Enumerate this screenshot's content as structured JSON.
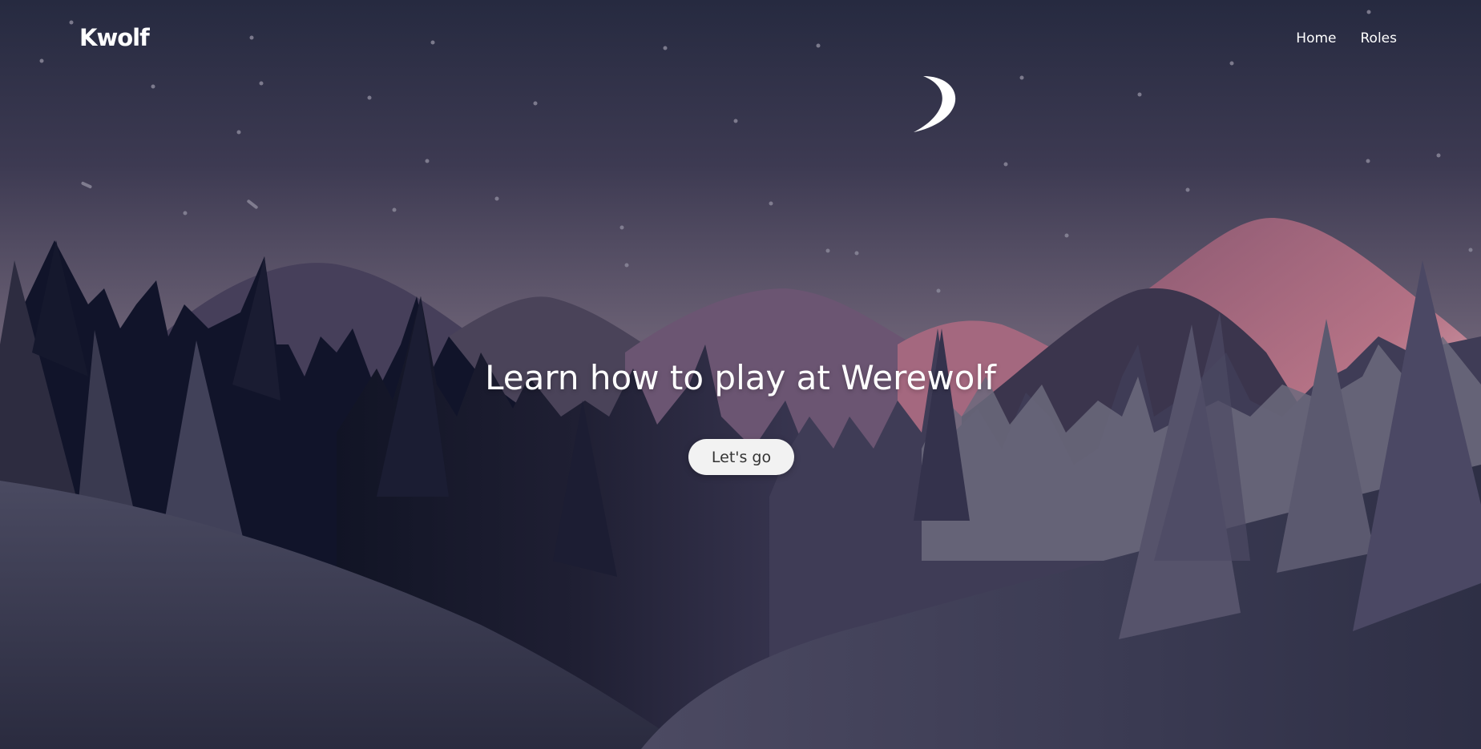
{
  "header": {
    "logo": "Kwolf",
    "nav": [
      {
        "label": "Home"
      },
      {
        "label": "Roles"
      }
    ]
  },
  "hero": {
    "title": "Learn how to play at Werewolf",
    "cta_label": "Let's go"
  },
  "colors": {
    "sky_top": "#262a40",
    "sky_horizon": "#6c6175",
    "pink_mountain": "#c07488",
    "button_bg": "#f2f2f2"
  },
  "icons": {
    "moon": "crescent-moon-icon"
  }
}
